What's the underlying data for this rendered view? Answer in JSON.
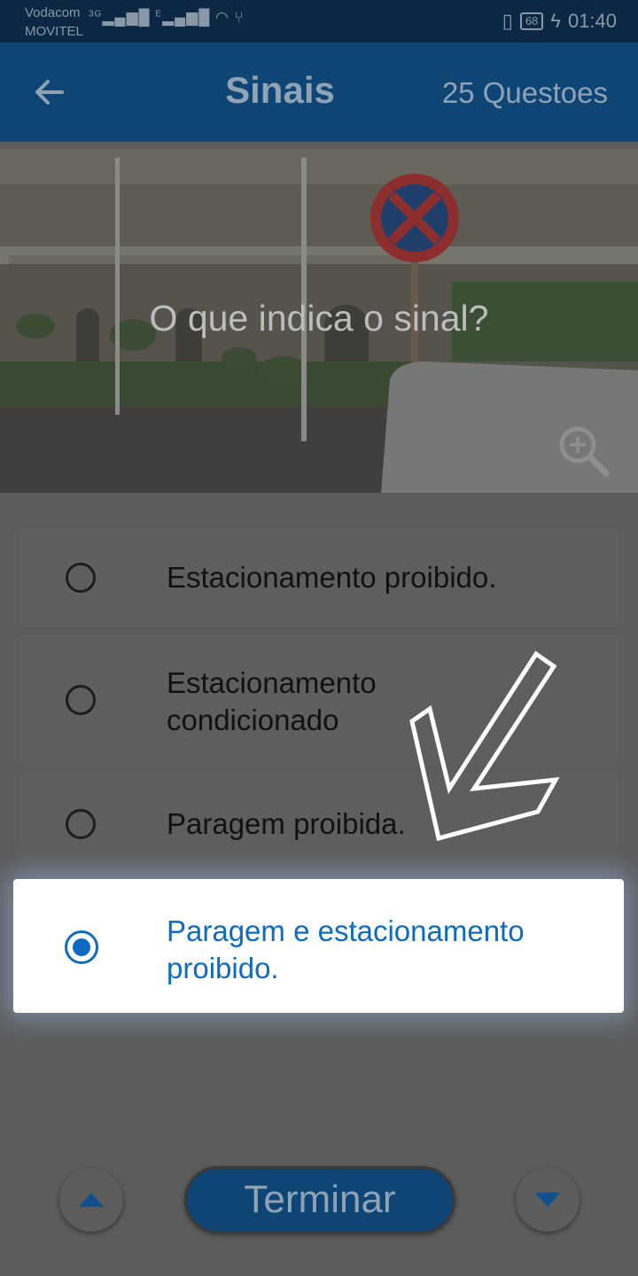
{
  "status_bar": {
    "carrier_1": "Vodacom",
    "carrier_2": "MOVITEL",
    "network_1": "3G",
    "network_2": "E",
    "battery": "68",
    "time": "01:40"
  },
  "app_bar": {
    "title": "Sinais",
    "question_count": "25 Questoes",
    "back_icon": "arrow-left-icon"
  },
  "question": {
    "text": "O que indica o sinal?",
    "image": "no-stopping-no-parking-sign-photo",
    "zoom_icon": "zoom-in-icon"
  },
  "options": [
    {
      "label": "Estacionamento proibido.",
      "selected": false
    },
    {
      "label": "Estacionamento condicionado",
      "selected": false
    },
    {
      "label": "Paragem proibida.",
      "selected": false
    },
    {
      "label": "Paragem e estacionamento proibido.",
      "selected": true
    }
  ],
  "footer": {
    "finish_label": "Terminar",
    "prev_icon": "chevron-up-icon",
    "next_icon": "chevron-down-icon"
  },
  "colors": {
    "app_bar": "#0e4575",
    "status_bar": "#0b2744",
    "accent": "#0d6cc2",
    "overlay": "#5c5c5c"
  }
}
